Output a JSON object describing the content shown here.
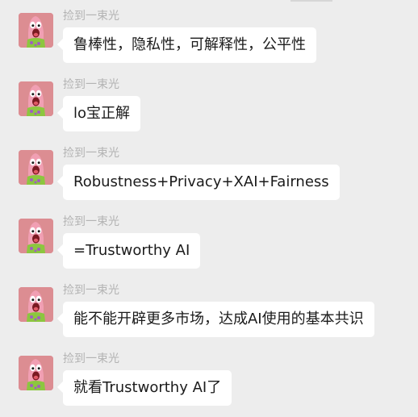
{
  "messages": [
    {
      "sender": "捡到一束光",
      "text": "鲁棒性，隐私性，可解释性，公平性"
    },
    {
      "sender": "捡到一束光",
      "text": "lo宝正解"
    },
    {
      "sender": "捡到一束光",
      "text": "Robustness+Privacy+XAI+Fairness"
    },
    {
      "sender": "捡到一束光",
      "text": "=Trustworthy AI"
    },
    {
      "sender": "捡到一束光",
      "text": "能不能开辟更多市场，达成AI使用的基本共识"
    },
    {
      "sender": "捡到一束光",
      "text": "就看Trustworthy AI了"
    }
  ],
  "colors": {
    "background": "#ededed",
    "bubble": "#ffffff",
    "sender_name": "#b3b3b3",
    "message_text": "#1b1b1b",
    "avatar_bg": "#dc8d92"
  },
  "avatar_icon": "cartoon-character-avatar-icon"
}
